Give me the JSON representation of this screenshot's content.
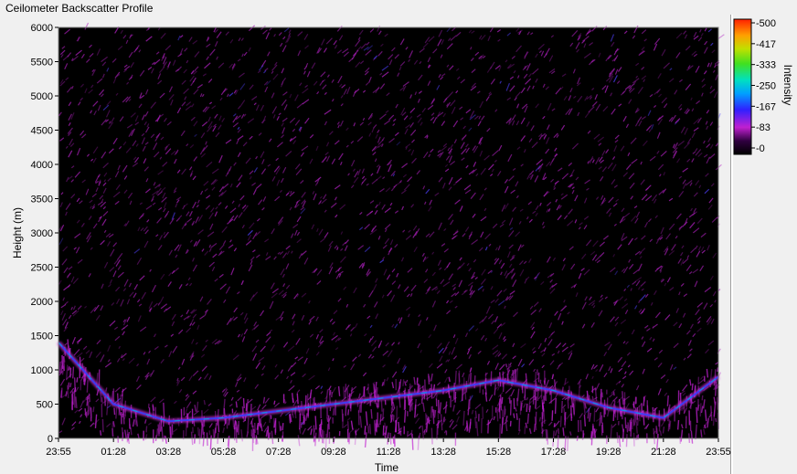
{
  "window": {
    "title": "Ceilometer Backscatter Profile"
  },
  "colors": {
    "plot_background": "#000000",
    "low_intensity": "#b020c0",
    "mid_intensity": "#2040ff",
    "high_intensity": "#ff4000",
    "axis_title": "#8b0000"
  },
  "chart_data": {
    "type": "heatmap",
    "title": "Ceilometer Backscatter Profile",
    "xlabel": "Time",
    "ylabel": "Height (m)",
    "x_ticks": [
      "23:55",
      "01:28",
      "03:28",
      "05:28",
      "07:28",
      "09:28",
      "11:28",
      "13:28",
      "15:28",
      "17:28",
      "19:28",
      "21:28",
      "23:55"
    ],
    "y_ticks": [
      0,
      500,
      1000,
      1500,
      2000,
      2500,
      3000,
      3500,
      4000,
      4500,
      5000,
      5500,
      6000
    ],
    "ylim": [
      0,
      6000
    ],
    "colorbar": {
      "label": "Intensity",
      "range": [
        0,
        500
      ],
      "ticks": [
        "-500",
        "-417",
        "-333",
        "-250",
        "-167",
        "-83",
        "-0"
      ]
    },
    "boundary_layer_top": {
      "time": [
        "23:55",
        "01:28",
        "03:28",
        "05:28",
        "07:28",
        "09:28",
        "11:28",
        "13:28",
        "15:28",
        "17:28",
        "19:28",
        "21:28",
        "23:55"
      ],
      "height_m": [
        1400,
        500,
        250,
        300,
        400,
        500,
        600,
        700,
        850,
        700,
        450,
        300,
        900
      ]
    },
    "grid": false
  }
}
